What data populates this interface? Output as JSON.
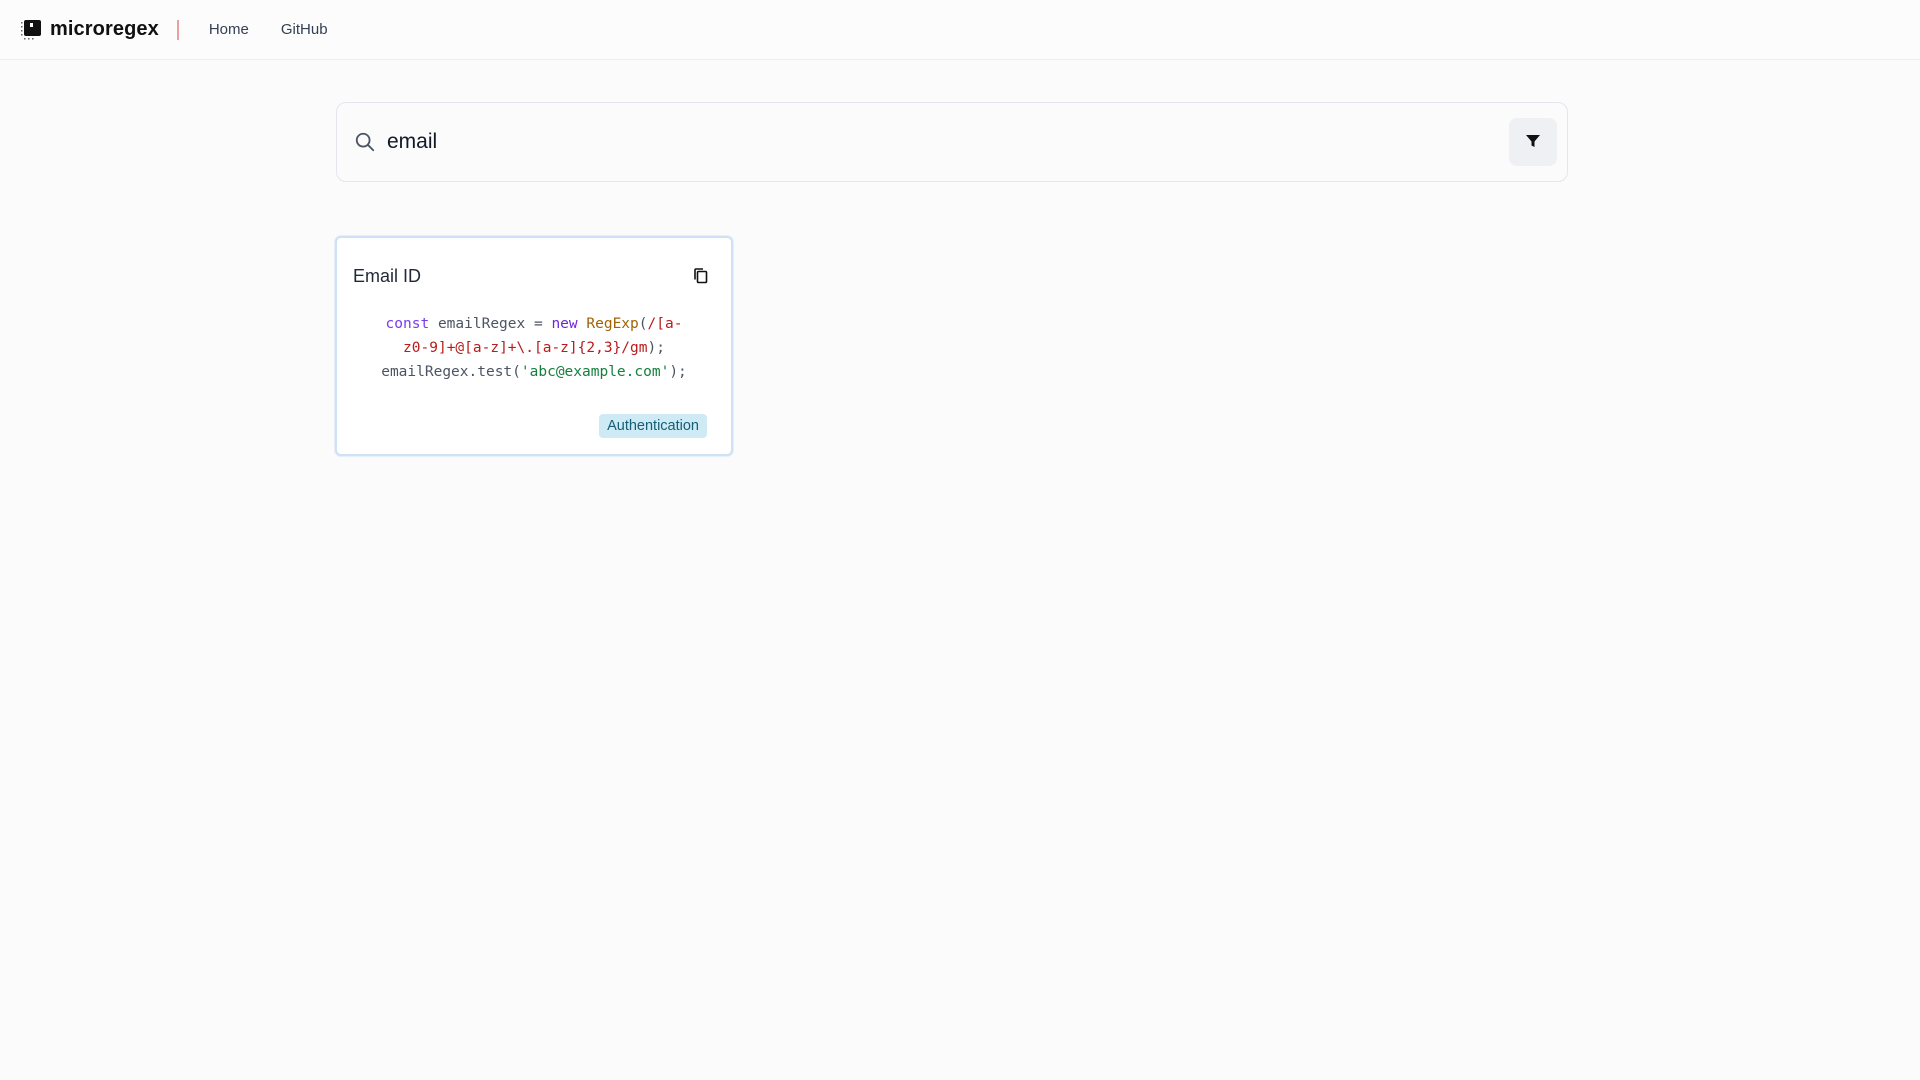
{
  "header": {
    "brand": "microregex",
    "nav": [
      {
        "label": "Home"
      },
      {
        "label": "GitHub"
      }
    ]
  },
  "search": {
    "value": "email",
    "placeholder": ""
  },
  "results": [
    {
      "title": "Email ID",
      "code": {
        "line1": {
          "kw_const": "const",
          "var": "emailRegex",
          "eq": "=",
          "kw_new": "new",
          "cls": "RegExp",
          "open": "(",
          "regex_part1": "/[a-"
        },
        "line2": {
          "regex_part2": "z0-9]+@[a-z]+\\.[a-z]{2,3}/gm",
          "close": ");"
        },
        "line3": {
          "call": "emailRegex.test(",
          "str": "'abc@example.com'",
          "close": ");"
        }
      },
      "tag": "Authentication"
    }
  ],
  "colors": {
    "tag_bg": "#cdeaf5",
    "tag_text": "#155e75",
    "card_border": "#cfe1f5",
    "divider": "#e8a0a0"
  },
  "icons": {
    "logo": "microregex-logo-icon",
    "search": "search-icon",
    "filter": "filter-funnel-icon",
    "copy": "copy-icon"
  }
}
